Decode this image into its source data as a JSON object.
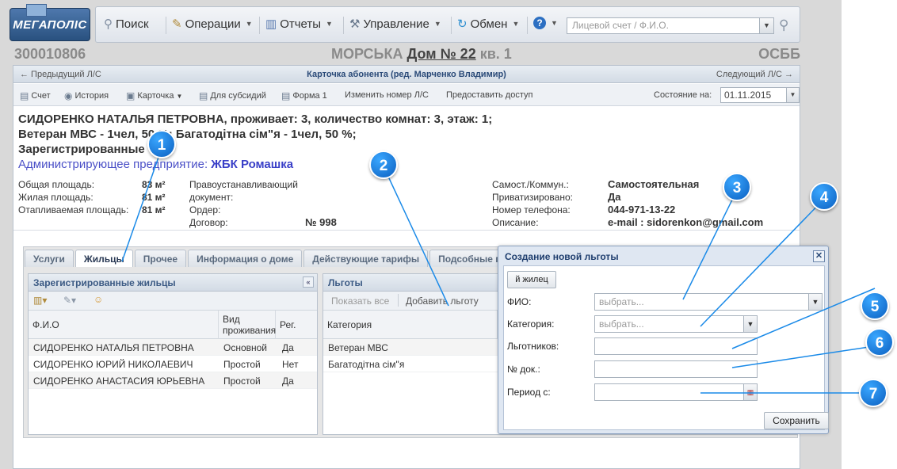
{
  "logo": {
    "text": "МЕГАПОЛІС"
  },
  "toolbar": {
    "search": "Поиск",
    "operations": "Операции",
    "reports": "Отчеты",
    "management": "Управление",
    "exchange": "Обмен",
    "search_placeholder": "Лицевой счет / Ф.И.О."
  },
  "header": {
    "account": "300010806",
    "street": "МОРСЬКА",
    "house": "Дом № 22",
    "apartment": "кв. 1",
    "osbb": "ОСББ"
  },
  "card": {
    "prev": "← Предыдущий Л/С",
    "title": "Карточка абонента (ред. Марченко Владимир)",
    "next": "Следующий Л/С →",
    "toolbar": {
      "account": "Счет",
      "history": "История",
      "card": "Карточка",
      "subsidy": "Для субсидий",
      "form1": "Форма 1",
      "change_account": "Изменить номер Л/С",
      "grant_access": "Предоставить доступ",
      "state_label": "Состояние на:",
      "state_date": "01.11.2015"
    },
    "info_line1": "СИДОРЕНКО НАТАЛЬЯ ПЕТРОВНА, проживает: 3, количество комнат: 3, этаж: 1;",
    "info_line2": "Ветеран МВС - 1чел, 50 %; Багатодітна сім\"я - 1чел, 50 %;",
    "info_line3": "Зарегистрированные",
    "admin_label": "Администрирующее предприятие:",
    "admin_value": "ЖБК Ромашка",
    "areas": {
      "total_label": "Общая площадь:",
      "total_value": "83 м²",
      "living_label": "Жилая площадь:",
      "living_value": "81 м²",
      "heated_label": "Отапливаемая площадь:",
      "heated_value": "81 м²"
    },
    "docs": {
      "title_doc_1": "Правоустанавливающий",
      "title_doc_2": "документ:",
      "order_label": "Ордер:",
      "contract_label": "Договор:",
      "contract_value": "№ 998"
    },
    "props": {
      "type_label": "Самост./Коммун.:",
      "type_value": "Самостоятельная",
      "priv_label": "Приватизировано:",
      "priv_value": "Да",
      "phone_label": "Номер телефона:",
      "phone_value": "044-971-13-22",
      "desc_label": "Описание:",
      "desc_value": "e-mail : sidorenkon@gmail.com"
    }
  },
  "tabs": [
    "Услуги",
    "Жильцы",
    "Прочее",
    "Информация о доме",
    "Действующие тарифы",
    "Подсобные п"
  ],
  "residents": {
    "title": "Зарегистрированные жильцы",
    "col_name": "Ф.И.О",
    "col_type_1": "Вид",
    "col_type_2": "проживания",
    "col_reg": "Рег.",
    "rows": [
      {
        "name": "СИДОРЕНКО НАТАЛЬЯ ПЕТРОВНА",
        "type": "Основной",
        "reg": "Да"
      },
      {
        "name": "СИДОРЕНКО ЮРИЙ НИКОЛАЕВИЧ",
        "type": "Простой",
        "reg": "Нет"
      },
      {
        "name": "СИДОРЕНКО АНАСТАСИЯ ЮРЬЕВНА",
        "type": "Простой",
        "reg": "Да"
      }
    ]
  },
  "benefits": {
    "title": "Льготы",
    "show_all": "Показать все",
    "add": "Добавить льготу",
    "col_category": "Категория",
    "rows": [
      "Ветеран МВС",
      "Багатодітна сім\"я"
    ]
  },
  "dialog": {
    "title": "Создание новой льготы",
    "resident_btn": "й жилец",
    "fio_label": "ФИО:",
    "fio_placeholder": "выбрать...",
    "category_label": "Категория:",
    "category_placeholder": "выбрать...",
    "count_label": "Льготников:",
    "doc_label": "№ док.:",
    "period_label": "Период с:",
    "save": "Сохранить"
  },
  "callouts": [
    "1",
    "2",
    "3",
    "4",
    "5",
    "6",
    "7"
  ],
  "colors": {
    "callout": "#1a7ee0",
    "link": "#3a40c8",
    "header_blue": "#2a4a78"
  }
}
